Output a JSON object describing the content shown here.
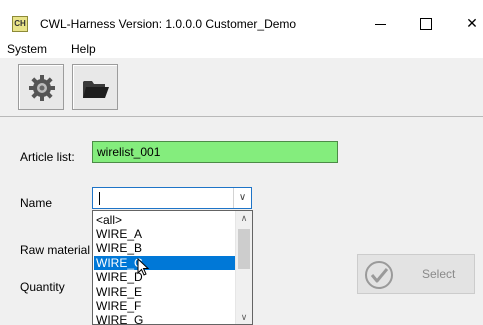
{
  "window": {
    "app_icon_text": "CH",
    "title": "CWL-Harness  Version: 1.0.0.0  Customer_Demo",
    "close_glyph": "✕"
  },
  "menu": {
    "items": [
      {
        "label": "System"
      },
      {
        "label": "Help"
      }
    ]
  },
  "toolbar": {
    "buttons": [
      {
        "icon": "gear-icon"
      },
      {
        "icon": "folder-icon"
      }
    ]
  },
  "form": {
    "article_label": "Article list:",
    "article_value": "wirelist_001",
    "name_label": "Name",
    "name_value": "",
    "raw_material_label": "Raw material",
    "quantity_label": "Quantity"
  },
  "dropdown": {
    "options": [
      "<all>",
      "WIRE_A",
      "WIRE_B",
      "WIRE_C",
      "WIRE_D",
      "WIRE_E",
      "WIRE_F",
      "WIRE_G"
    ],
    "selected_index": 3
  },
  "select_button": {
    "label": "Select",
    "enabled": false
  },
  "colors": {
    "article_field_bg": "#84ed7d",
    "selection": "#0078d7"
  }
}
